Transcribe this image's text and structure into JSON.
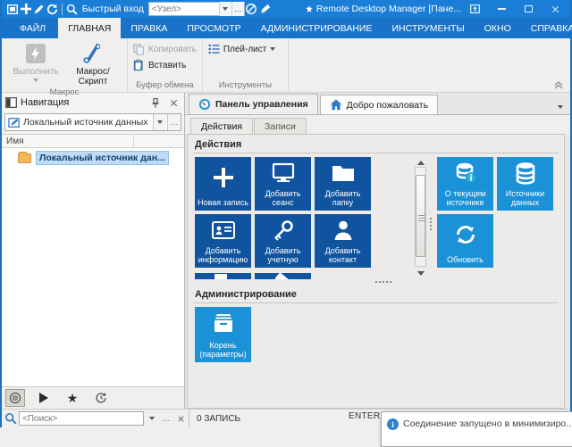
{
  "titlebar": {
    "quick_connect_label": "Быстрый вход",
    "host_placeholder": "<Узел>",
    "window_title": "Remote Desktop Manager [Пане..."
  },
  "ribbon": {
    "tabs": [
      "ФАЙЛ",
      "ГЛАВНАЯ",
      "ПРАВКА",
      "ПРОСМОТР",
      "АДМИНИСТРИРОВАНИЕ",
      "ИНСТРУМЕНТЫ",
      "ОКНО",
      "СПРАВКА"
    ],
    "run_label": "Выполнить",
    "macro_label": "Макрос/Скрипт",
    "copy_label": "Копировать",
    "paste_label": "Вставить",
    "playlist_label": "Плей-лист",
    "group_macro": "Макрос",
    "group_clipboard": "Буфер обмена",
    "group_tools": "Инструменты"
  },
  "navigation": {
    "title": "Навигация",
    "datasource_value": "Локальный источник данных",
    "column_name": "Имя",
    "tree_item": "Локальный источник дан...",
    "search_placeholder": "<Поиск>"
  },
  "main": {
    "doc_tab_dashboard": "Панель управления",
    "doc_tab_welcome": "Добро пожаловать",
    "sub_tab_actions": "Действия",
    "sub_tab_entries": "Записи",
    "section_actions": "Действия",
    "section_admin": "Администрирование",
    "tiles": {
      "new_entry": "Новая запись",
      "add_session": "Добавить сеанс",
      "add_folder": "Добавить папку",
      "add_information": "Добавить информацию",
      "add_credentials": "Добавить учетную",
      "add_contact": "Добавить контакт",
      "current_source": "О текущем источнике",
      "data_sources": "Источники данных",
      "refresh": "Обновить",
      "root_settings": "Корень (параметры)"
    }
  },
  "statusbar": {
    "records": "0 ЗАПИСЬ",
    "edition": "ENTERPRISE"
  },
  "toast": {
    "message": "Соединение запущено в минимизиро..."
  },
  "misc": {
    "ellipsis": "…"
  },
  "colors": {
    "titlebar_blue": "#1a7ed6",
    "ribbon_tab_blue": "#1973c8",
    "tile_dark_blue": "#10539e",
    "tile_light_blue": "#1b91d8",
    "selection_blue": "#bfdcf4"
  }
}
